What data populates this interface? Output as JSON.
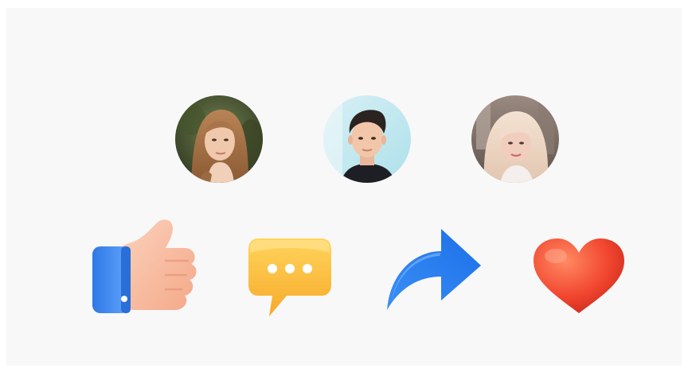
{
  "avatars": [
    {
      "icon": "avatar-woman-brown-hair-icon"
    },
    {
      "icon": "avatar-man-dark-hair-icon"
    },
    {
      "icon": "avatar-woman-blonde-hair-icon"
    }
  ],
  "reactions": [
    {
      "icon": "thumbs-up-icon",
      "color": "#3b8cf0"
    },
    {
      "icon": "comment-bubble-icon",
      "color": "#ffc93e"
    },
    {
      "icon": "share-arrow-icon",
      "color": "#2f86f5"
    },
    {
      "icon": "heart-icon",
      "color": "#f1462f"
    }
  ],
  "colors": {
    "background": "#f8f8f8"
  }
}
